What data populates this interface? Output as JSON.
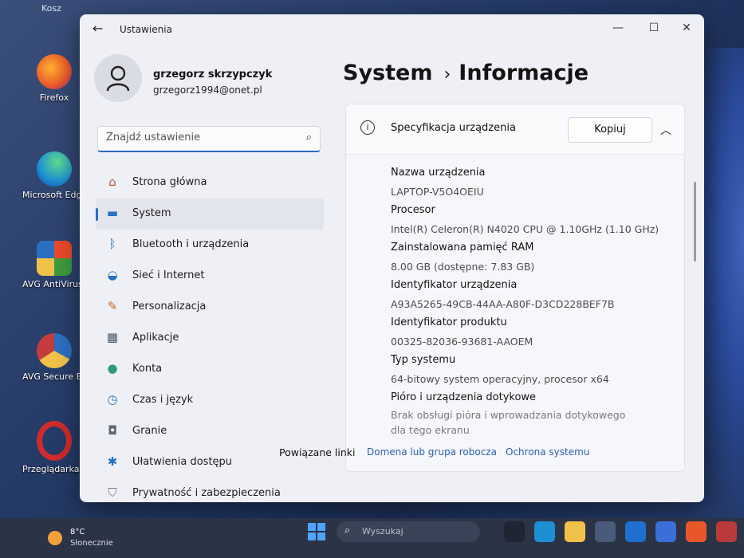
{
  "desktop": {
    "top_label": "Kosz",
    "icons": [
      {
        "label": "Firefox",
        "color": "#e8572a"
      },
      {
        "label": "Microsoft Edge",
        "color": "#1d8fd3"
      },
      {
        "label": "AVG AntiVirus Free",
        "color": "#3d9a3d"
      },
      {
        "label": "AVG Secure Browser",
        "color": "#c43c3c"
      },
      {
        "label": "Przeglądarka Opera",
        "color": "#d12a2a"
      }
    ]
  },
  "window": {
    "title": "Ustawienia",
    "back_icon": "←",
    "controls": {
      "minimize": "—",
      "maximize": "☐",
      "close": "✕"
    }
  },
  "profile": {
    "name": "grzegorz skrzypczyk",
    "email": "grzegorz1994@onet.pl"
  },
  "search": {
    "placeholder": "Znajdź ustawienie",
    "icon": "⌕"
  },
  "nav": {
    "items": [
      {
        "label": "Strona główna",
        "icon": "home-icon",
        "glyph": "⌂",
        "color": "#b2552e"
      },
      {
        "label": "System",
        "icon": "system-icon",
        "glyph": "▬",
        "color": "#2a6fc2",
        "active": true
      },
      {
        "label": "Bluetooth i urządzenia",
        "icon": "bluetooth-icon",
        "glyph": "ᛒ",
        "color": "#2a6fc2"
      },
      {
        "label": "Sieć i Internet",
        "icon": "wifi-icon",
        "glyph": "◒",
        "color": "#2a6fc2"
      },
      {
        "label": "Personalizacja",
        "icon": "brush-icon",
        "glyph": "✎",
        "color": "#c2652a"
      },
      {
        "label": "Aplikacje",
        "icon": "apps-icon",
        "glyph": "▦",
        "color": "#4a5568"
      },
      {
        "label": "Konta",
        "icon": "account-icon",
        "glyph": "●",
        "color": "#2e9b7a"
      },
      {
        "label": "Czas i język",
        "icon": "globe-clock-icon",
        "glyph": "◷",
        "color": "#2a6fc2"
      },
      {
        "label": "Granie",
        "icon": "gamepad-icon",
        "glyph": "◘",
        "color": "#606672"
      },
      {
        "label": "Ułatwienia dostępu",
        "icon": "accessibility-icon",
        "glyph": "✱",
        "color": "#2a6fc2"
      },
      {
        "label": "Prywatność i zabezpieczenia",
        "icon": "shield-icon",
        "glyph": "⛉",
        "color": "#7a7f8a"
      }
    ]
  },
  "page": {
    "title_parent": "System",
    "separator": "›",
    "title": "Informacje"
  },
  "card": {
    "title": "Specyfikacja urządzenia",
    "copy_label": "Kopiuj",
    "specs": [
      {
        "label": "Nazwa urządzenia",
        "value": "LAPTOP-V5O4OEIU"
      },
      {
        "label": "Procesor",
        "value": "Intel(R) Celeron(R) N4020 CPU @ 1.10GHz (1.10 GHz)"
      },
      {
        "label": "Zainstalowana pamięć RAM",
        "value": "8.00 GB (dostępne: 7.83 GB)"
      },
      {
        "label": "Identyfikator urządzenia",
        "value": "A93A5265-49CB-44AA-A80F-D3CD228BEF7B"
      },
      {
        "label": "Identyfikator produktu",
        "value": "00325-82036-93681-AAOEM"
      },
      {
        "label": "Typ systemu",
        "value": "64-bitowy system operacyjny, procesor x64"
      },
      {
        "label": "Pióro i urządzenia dotykowe",
        "value": "Brak obsługi pióra i wprowadzania dotykowego dla tego ekranu"
      }
    ]
  },
  "related": {
    "label": "Powiązane linki",
    "links": [
      "Domena lub grupa robocza",
      "Ochrona systemu"
    ]
  },
  "taskbar": {
    "weather_temp": "8°C",
    "weather_cond": "Słonecznie",
    "search_placeholder": "Wyszukaj",
    "apps": [
      {
        "name": "task-view",
        "color": "#1f2533"
      },
      {
        "name": "edge",
        "color": "#1d8fd3"
      },
      {
        "name": "explorer",
        "color": "#f0c24a"
      },
      {
        "name": "store",
        "color": "#4a5a7a"
      },
      {
        "name": "outlook",
        "color": "#1f6fd0"
      },
      {
        "name": "app-1",
        "color": "#3a6fd8"
      },
      {
        "name": "firefox",
        "color": "#e8572a"
      },
      {
        "name": "app-2",
        "color": "#b83a3a"
      }
    ]
  }
}
